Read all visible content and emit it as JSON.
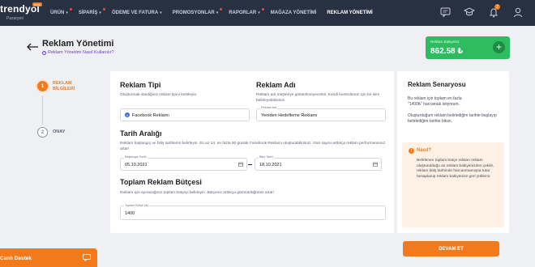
{
  "brand": {
    "name": "trendyol",
    "sub": "Pazaryeri",
    "badge": "beta"
  },
  "nav": {
    "items": [
      {
        "label": "ÜRÜN",
        "dropdown": true,
        "dot": true
      },
      {
        "label": "SİPARİŞ",
        "dropdown": true,
        "dot": true
      },
      {
        "label": "ÖDEME VE FATURA",
        "dropdown": true,
        "dot": false
      },
      {
        "label": "PROMOSYONLAR",
        "dropdown": true,
        "dot": true
      },
      {
        "label": "RAPORLAR",
        "dropdown": true,
        "dot": true
      },
      {
        "label": "MAĞAZA YÖNETİMİ",
        "dropdown": false,
        "dot": false
      },
      {
        "label": "REKLAM YÖNETİMİ",
        "dropdown": false,
        "dot": false,
        "active": true
      }
    ],
    "icons": [
      "chat-icon",
      "graduation-cap-icon",
      "bell-icon",
      "user-icon"
    ],
    "notification_count": "2"
  },
  "header": {
    "title": "Reklam Yönetimi",
    "help_link": "Reklam Yönetimi Nasıl Kullanılır?"
  },
  "balance": {
    "label": "Reklam Bakiyeniz",
    "value": "862.58 ₺",
    "add_symbol": "+"
  },
  "steps": [
    {
      "number": "1",
      "label": "REKLAM BİLGİLERİ",
      "active": true
    },
    {
      "number": "2",
      "label": "ONAY",
      "active": false
    }
  ],
  "form": {
    "type": {
      "title": "Reklam Tipi",
      "desc": "Oluşturmak istediğiniz reklam tipini belirleyin.",
      "value": "Facebook Reklamı"
    },
    "name": {
      "title": "Reklam Adı",
      "desc": "Reklam adı müşteriye gösterilmeyecektir. Kendi kontrolünüz için bir isim belirleyebilirsiniz.",
      "field_label": "Reklam Adı",
      "value": "Yeniden Hedefleme Reklamı"
    },
    "dates": {
      "title": "Tarih Aralığı",
      "desc": "Reklam başlangıç ve bitiş tarihlerini belirleyin. En az 14, en fazla 90 günlük Facebook Reklamı oluşturabilirsiniz. Gün sayısı arttıkça reklam performansınız artar!",
      "start_label": "Başlangıç Tarihi",
      "start_value": "05.10.2021",
      "end_label": "Bitiş Tarihi",
      "end_value": "18.10.2021"
    },
    "budget": {
      "title": "Toplam Reklam Bütçesi",
      "desc": "Reklam için ayıracağınız toplam bütçeyi belirleyin. Bütçeniz arttıkça görünürlüğünüz artar!",
      "field_label": "Toplam Bütçe (₺)",
      "value": "1400"
    }
  },
  "scenario": {
    "title": "Reklam Senaryosu",
    "line1_a": "Bu reklam için toplam en fazla",
    "line1_b": "\"1400₺\" harcamak istiyorum.",
    "line2": "Oluşturduğum reklam belirlediğim tarihte başlayıp belirlediğim tarihte bitsin.",
    "note_title": "Nasıl?",
    "note_text": "Belirlenen toplam bütçe miktarı reklam oluşturulduğu an reklam bakiyenizden çekilir, reklam bitiş tarihinde harcanmamışsa tutar hesaplanıp reklam bakiyenize geri yüklenir."
  },
  "actions": {
    "next": "DEVAM ET"
  },
  "support": {
    "label": "Canlı Destek"
  },
  "colors": {
    "accent": "#f27a1a",
    "nav_bg": "#273142",
    "balance_bg": "#2fbb5f"
  }
}
